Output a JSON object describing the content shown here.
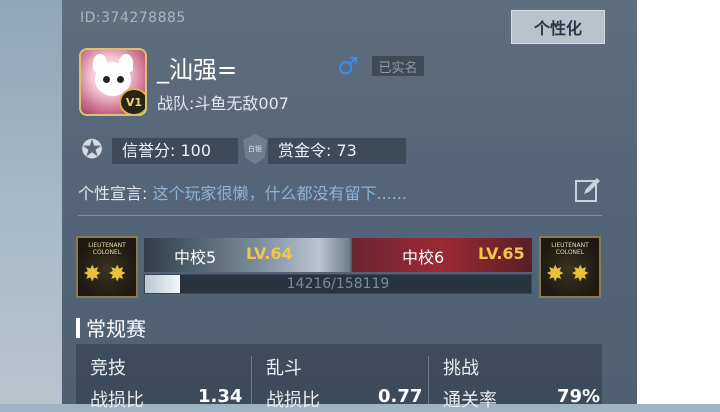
{
  "profile": {
    "player_id": "ID:374278885",
    "customize_label": "个性化",
    "name": "_汕强=",
    "gender_symbol": "♂",
    "verified_label": "已实名",
    "team": "战队:斗鱼无敌007",
    "vip_level": "V1"
  },
  "reputation": {
    "honor": "信誉分: 100",
    "bounty": "赏金令: 73",
    "bounty_icon_text": "白银"
  },
  "motto": {
    "label": "个性宣言:",
    "text": "这个玩家很懒，什么都没有留下......"
  },
  "rank": {
    "badge_text": "LIEUTENANT COLONEL",
    "current_name": "中校5",
    "current_level": "LV.64",
    "next_name": "中校6",
    "next_level": "LV.65",
    "exp_text": "14216/158119",
    "exp_progress": 0.0899
  },
  "section": {
    "title": "常规赛"
  },
  "stats": [
    {
      "title": "竞技",
      "label": "战损比",
      "value": "1.34"
    },
    {
      "title": "乱斗",
      "label": "战损比",
      "value": "0.77"
    },
    {
      "title": "挑战",
      "label": "通关率",
      "value": "79%"
    }
  ],
  "colors": {
    "accent_gold": "#f2c64a",
    "gender_blue": "#3a8df0",
    "motto_blue": "#8db3d6",
    "next_rank_red": "#9b2a35"
  }
}
